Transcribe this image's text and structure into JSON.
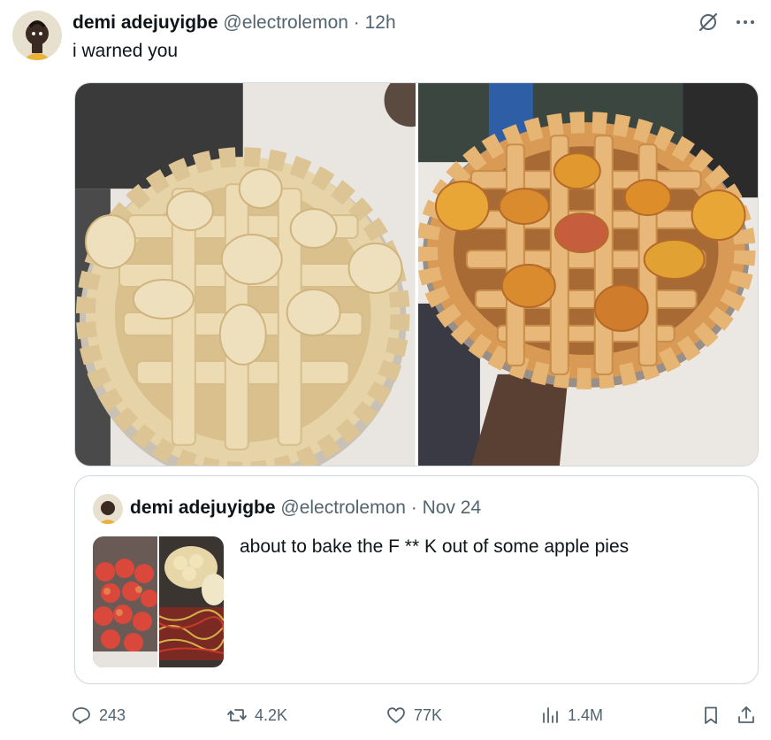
{
  "tweet": {
    "display_name": "demi adejuyigbe",
    "handle": "@electrolemon",
    "separator": " · ",
    "time": "12h",
    "text": "i warned you"
  },
  "top_icons": [
    "grok-icon",
    "more-icon"
  ],
  "media": [
    {
      "name": "unbaked lattice apple pie"
    },
    {
      "name": "baked lattice apple pie"
    }
  ],
  "quoted": {
    "display_name": "demi adejuyigbe",
    "handle": "@electrolemon",
    "separator": " · ",
    "time": "Nov 24",
    "text": "about to bake the F ** K out of some apple pies"
  },
  "actions": {
    "replies": "243",
    "reposts": "4.2K",
    "likes": "77K",
    "views": "1.4M"
  },
  "colors": {
    "text": "#0f1419",
    "secondary": "#536471",
    "border": "#cfd9de"
  }
}
